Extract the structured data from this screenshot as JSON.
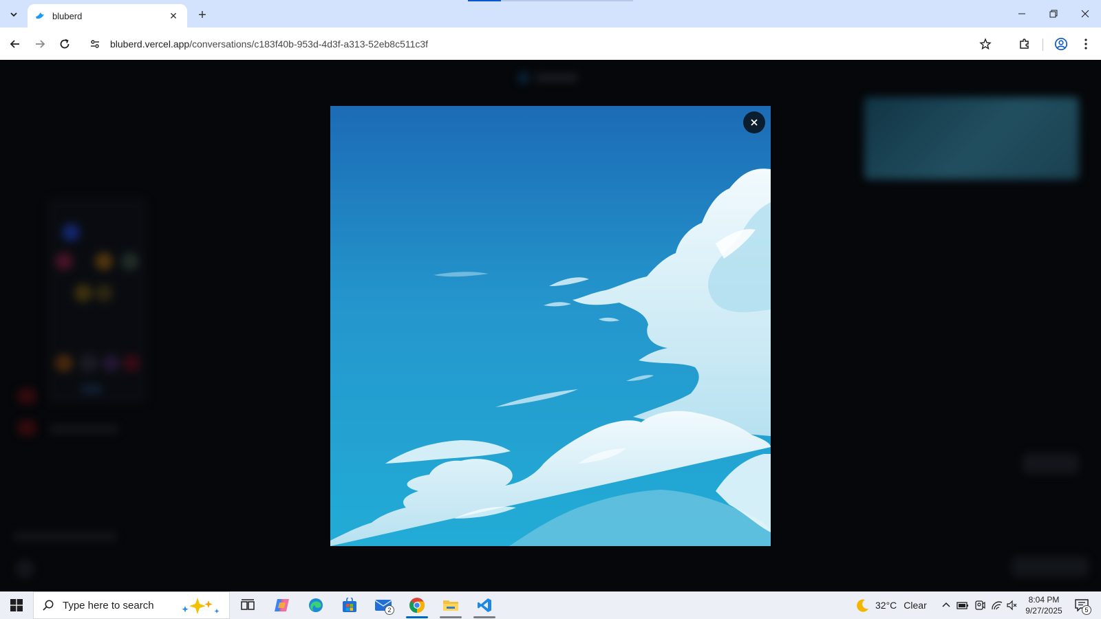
{
  "browser": {
    "tab": {
      "title": "bluberd",
      "favicon": "bird-icon"
    },
    "url": {
      "host": "bluberd.vercel.app",
      "path": "/conversations/c183f40b-953d-4d3f-a313-52eb8c511c3f"
    },
    "window_controls": {
      "minimize": "–",
      "restore": "❐",
      "close": "✕"
    }
  },
  "modal": {
    "image_subject": "sky-with-clouds-illustration",
    "close_symbol": "✕",
    "colors": {
      "sky_top": "#1c6bb5",
      "sky_mid": "#2496cc",
      "sky_bottom": "#22a9d4",
      "cloud": "#eaf6fb",
      "cloud_shadow": "#9fd3e8"
    }
  },
  "taskbar": {
    "search_placeholder": "Type here to search",
    "mail_badge": "2",
    "weather": {
      "temperature": "32°C",
      "condition": "Clear"
    },
    "clock": {
      "time": "8:04 PM",
      "date": "9/27/2025"
    },
    "notification_count": "5"
  }
}
